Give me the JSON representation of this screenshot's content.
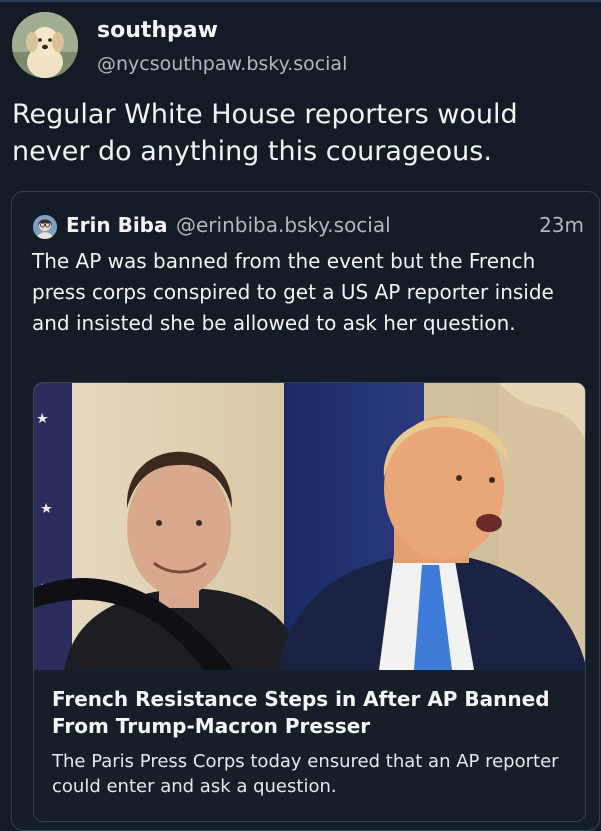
{
  "post": {
    "author": {
      "display_name": "southpaw",
      "handle": "@nycsouthpaw.bsky.social"
    },
    "text": "Regular White House reporters would never do anything this courageous."
  },
  "quoted_post": {
    "author": {
      "display_name": "Erin Biba",
      "handle": "@erinbiba.bsky.social"
    },
    "time": "23m",
    "text": "The AP was banned from the event but the French press corps conspired to get a US AP reporter inside and insisted she be allowed to ask her question.",
    "link_card": {
      "title": "French Resistance Steps in After AP Banned From Trump-Macron Presser",
      "description": "The Paris Press Corps today ensured that an AP reporter could enter and ask a question."
    }
  },
  "colors": {
    "background": "#131c26",
    "border": "#33414f",
    "text_primary": "#f1f3f5",
    "text_secondary": "#aeb8c3"
  }
}
